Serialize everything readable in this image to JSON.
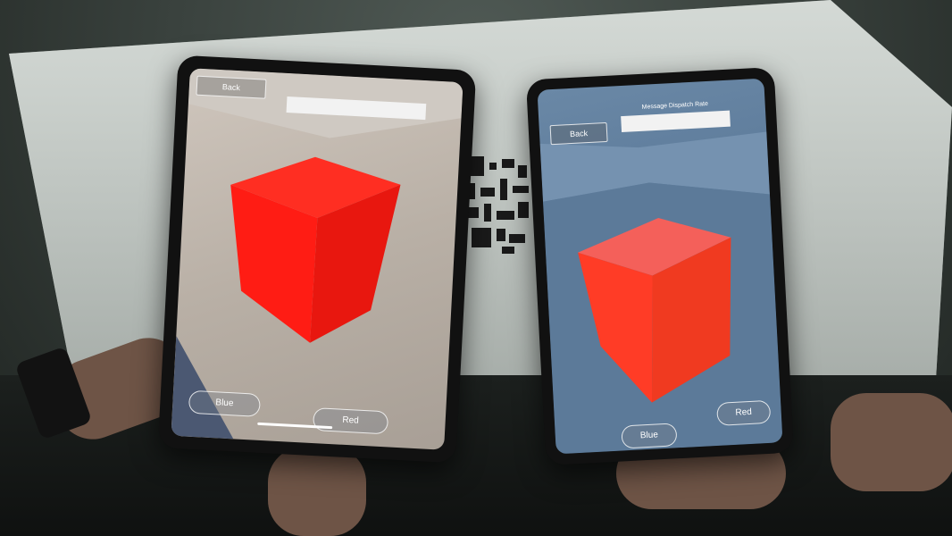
{
  "left_device": {
    "back_label": "Back",
    "blue_label": "Blue",
    "red_label": "Red"
  },
  "right_device": {
    "back_label": "Back",
    "title": "Message Dispatch Rate",
    "blue_label": "Blue",
    "red_label": "Red"
  },
  "colors": {
    "cube_red": "#ff2a1a",
    "cube_dark_red": "#d81410"
  }
}
